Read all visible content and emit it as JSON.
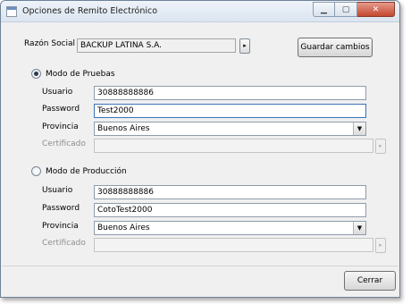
{
  "window": {
    "title": "Opciones de Remito Electrónico",
    "minimize_glyph": "▁",
    "maximize_glyph": "▢",
    "close_glyph": "✕"
  },
  "razon_social": {
    "label": "Razón Social",
    "value": "BACKUP LATINA S.A.",
    "button_glyph": "▸"
  },
  "save_button": "Guardar cambios",
  "pruebas": {
    "label": "Modo de Pruebas",
    "checked": true,
    "usuario_label": "Usuario",
    "usuario": "30888888886",
    "password_label": "Password",
    "password": "Test2000",
    "provincia_label": "Provincia",
    "provincia": "Buenos Aires",
    "certificado_label": "Certificado",
    "certificado": "",
    "cert_button_glyph": "▸"
  },
  "produccion": {
    "label": "Modo de Producción",
    "checked": false,
    "usuario_label": "Usuario",
    "usuario": "30888888886",
    "password_label": "Password",
    "password": "CotoTest2000",
    "provincia_label": "Provincia",
    "provincia": "Buenos Aires",
    "certificado_label": "Certificado",
    "certificado": "",
    "cert_button_glyph": "▸"
  },
  "close_button": "Cerrar",
  "dropdown_glyph": "▼"
}
